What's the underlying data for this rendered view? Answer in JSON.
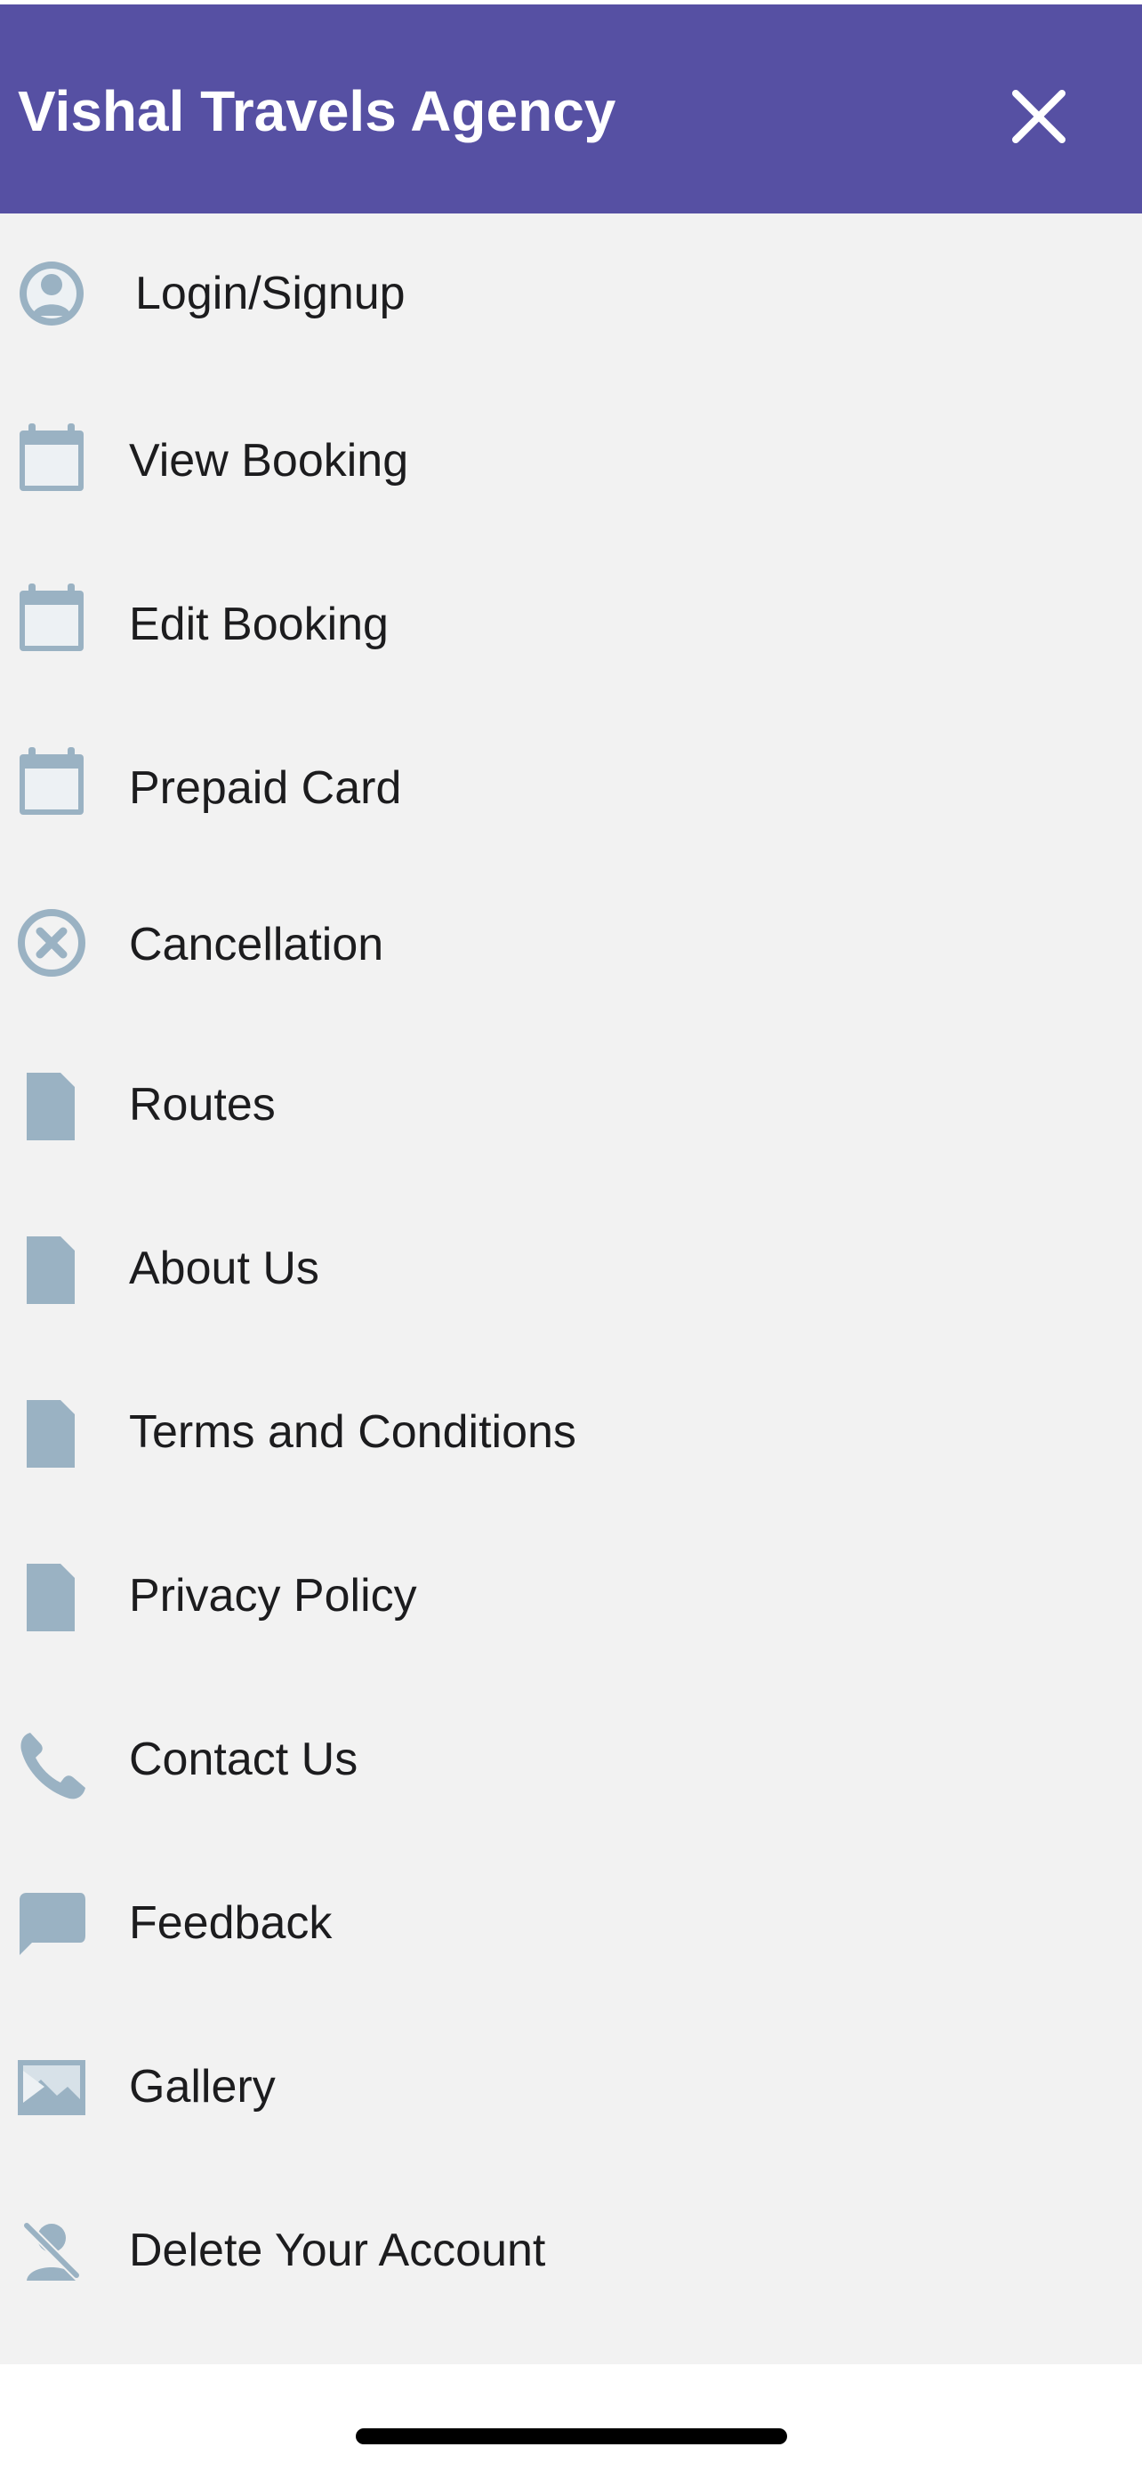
{
  "app": {
    "title": "Vishal Travels Agency",
    "header_color": "#5650a3",
    "icon_color": "#9ab2c3",
    "close_icon": "close-icon"
  },
  "menu": {
    "items": [
      {
        "label": "Login/Signup",
        "icon": "user-icon"
      },
      {
        "label": "View Booking",
        "icon": "calendar-icon"
      },
      {
        "label": "Edit Booking",
        "icon": "calendar-icon"
      },
      {
        "label": "Prepaid Card",
        "icon": "calendar-icon"
      },
      {
        "label": "Cancellation",
        "icon": "cancel-circle-icon"
      },
      {
        "label": "Routes",
        "icon": "document-icon"
      },
      {
        "label": "About Us",
        "icon": "document-icon"
      },
      {
        "label": "Terms and Conditions",
        "icon": "document-icon"
      },
      {
        "label": "Privacy Policy",
        "icon": "document-icon"
      },
      {
        "label": "Contact Us",
        "icon": "phone-icon"
      },
      {
        "label": "Feedback",
        "icon": "chat-icon"
      },
      {
        "label": "Gallery",
        "icon": "image-icon"
      },
      {
        "label": "Delete Your Account",
        "icon": "delete-account-icon"
      }
    ]
  }
}
